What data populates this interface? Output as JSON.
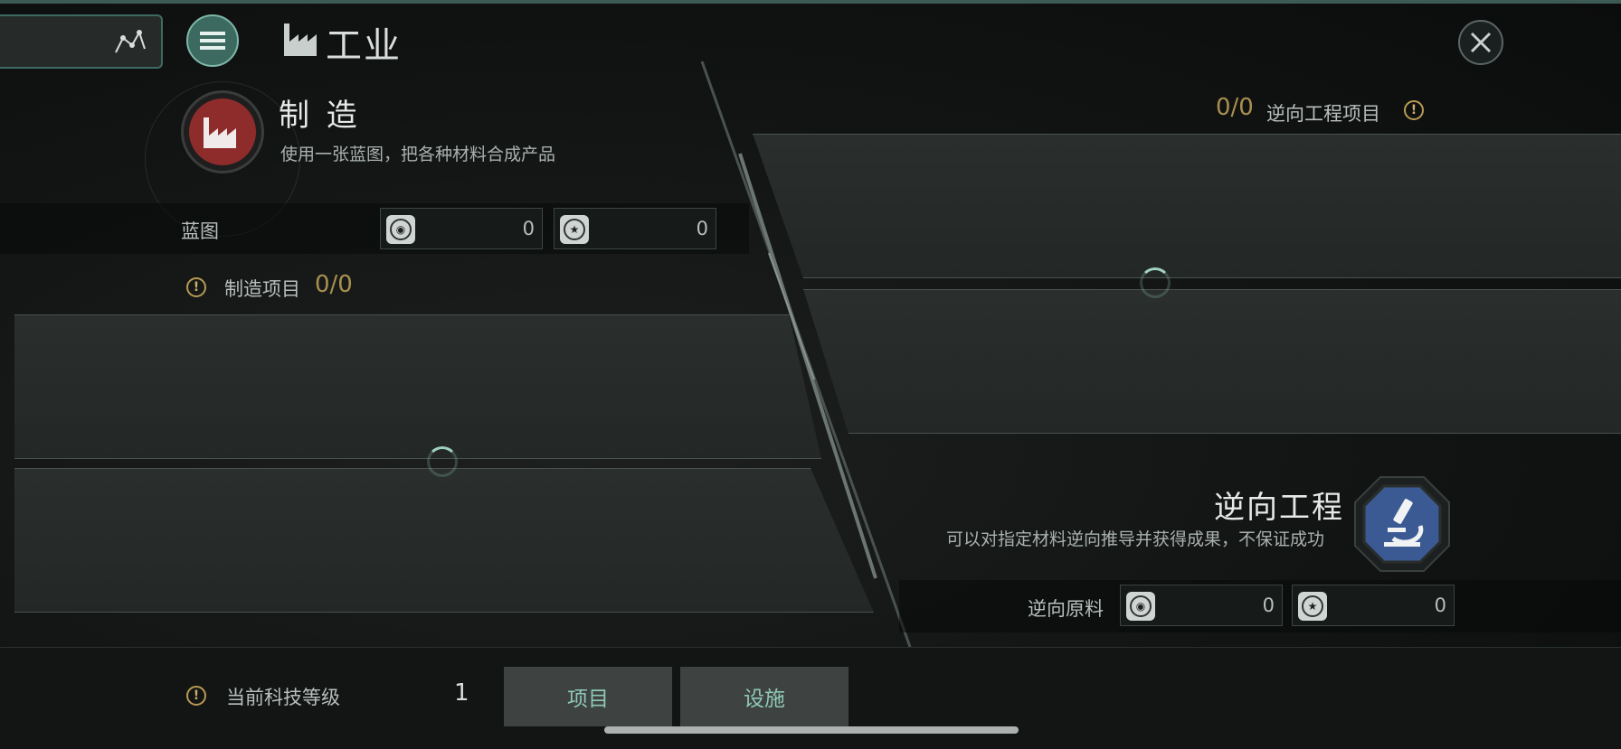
{
  "header": {
    "title": "工业",
    "nav_icon": "star-map-icon",
    "menu_icon": "menu-icon",
    "title_icon": "factory-icon",
    "close_icon": "close-icon"
  },
  "manufacture": {
    "title": "制 造",
    "description": "使用一张蓝图，把各种材料合成产品",
    "icon": "factory-icon",
    "blueprint_label": "蓝图",
    "blueprint_resources": [
      {
        "icon": "blueprint-original-icon",
        "value": "0"
      },
      {
        "icon": "blueprint-copy-icon",
        "value": "0"
      }
    ],
    "items_label": "制造项目",
    "items_count": "0/0"
  },
  "reverse": {
    "count": "0/0",
    "items_label": "逆向工程项目",
    "title": "逆向工程",
    "description": "可以对指定材料逆向推导并获得成果，不保证成功",
    "icon": "microscope-icon",
    "material_label": "逆向原料",
    "material_resources": [
      {
        "icon": "material-original-icon",
        "value": "0"
      },
      {
        "icon": "material-copy-icon",
        "value": "0"
      }
    ]
  },
  "footer": {
    "tech_label": "当前科技等级",
    "tech_level": "1",
    "tabs": [
      "项目",
      "设施"
    ]
  },
  "colors": {
    "accent": "#3c6a60",
    "gold": "#a8904e",
    "manufacture_icon": "#8e2c2c",
    "reverse_icon": "#3b5a94"
  }
}
